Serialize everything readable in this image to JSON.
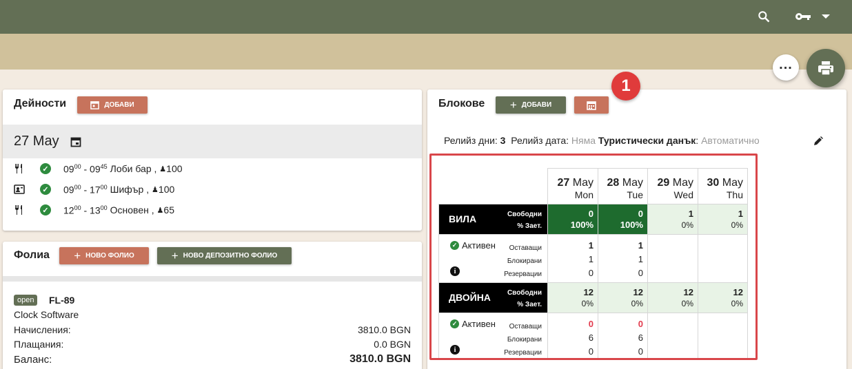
{
  "header": {
    "search_icon": "search-icon",
    "key_icon": "key-icon",
    "menu_icon": "chevron-down-icon"
  },
  "activities": {
    "title": "Дейности",
    "add_label": "ДОБАВИ",
    "date": "27 May",
    "rows": [
      {
        "icon": "restaurant-icon",
        "start_h": "09",
        "start_m": "00",
        "end_h": "09",
        "end_m": "45",
        "name": "Лоби бар",
        "guests": "100"
      },
      {
        "icon": "presentation-icon",
        "start_h": "09",
        "start_m": "00",
        "end_h": "17",
        "end_m": "00",
        "name": "Шифър",
        "guests": "100"
      },
      {
        "icon": "restaurant-icon",
        "start_h": "12",
        "start_m": "00",
        "end_h": "13",
        "end_m": "00",
        "name": "Основен",
        "guests": "65"
      }
    ]
  },
  "folios": {
    "title": "Фолиа",
    "new_folio": "НОВО ФОЛИО",
    "new_deposit_folio": "НОВО ДЕПОЗИТНО ФОЛИО",
    "status": "open",
    "number": "FL-89",
    "company": "Clock Software",
    "charges_label": "Начисления:",
    "charges_value": "3810.0 BGN",
    "payments_label": "Плащания:",
    "payments_value": "0.0 BGN",
    "balance_label": "Баланс:",
    "balance_value": "3810.0 BGN"
  },
  "blocks": {
    "title": "Блокове",
    "add_label": "ДОБАВИ",
    "notification_count": "1",
    "release_days_label": "Релийз дни:",
    "release_days_value": "3",
    "release_date_label": "Релийз дата:",
    "release_date_value": "Няма",
    "tax_label": "Туристически данък",
    "tax_value": "Автоматично",
    "dates": [
      {
        "day": "27",
        "month": "May",
        "weekday": "Mon"
      },
      {
        "day": "28",
        "month": "May",
        "weekday": "Tue"
      },
      {
        "day": "29",
        "month": "May",
        "weekday": "Wed"
      },
      {
        "day": "30",
        "month": "May",
        "weekday": "Thu"
      }
    ],
    "free_label": "Свободни",
    "occupancy_label": "% Зает.",
    "active_label": "Активен",
    "remaining_label": "Оставащи",
    "blocked_label": "Блокирани",
    "reservations_label": "Резервации",
    "rooms": [
      {
        "name": "ВИЛА",
        "availability": [
          {
            "free": "0",
            "pct": "100%"
          },
          {
            "free": "0",
            "pct": "100%"
          },
          {
            "free": "1",
            "pct": "0%"
          },
          {
            "free": "1",
            "pct": "0%"
          }
        ],
        "stats": [
          {
            "remaining": "1",
            "blocked": "1",
            "reservations": "0"
          },
          {
            "remaining": "1",
            "blocked": "1",
            "reservations": "0"
          }
        ]
      },
      {
        "name": "ДВОЙНА",
        "availability": [
          {
            "free": "12",
            "pct": "0%"
          },
          {
            "free": "12",
            "pct": "0%"
          },
          {
            "free": "12",
            "pct": "0%"
          },
          {
            "free": "12",
            "pct": "0%"
          }
        ],
        "stats": [
          {
            "remaining": "0",
            "blocked": "6",
            "reservations": "0"
          },
          {
            "remaining": "0",
            "blocked": "6",
            "reservations": "0"
          }
        ]
      }
    ]
  }
}
